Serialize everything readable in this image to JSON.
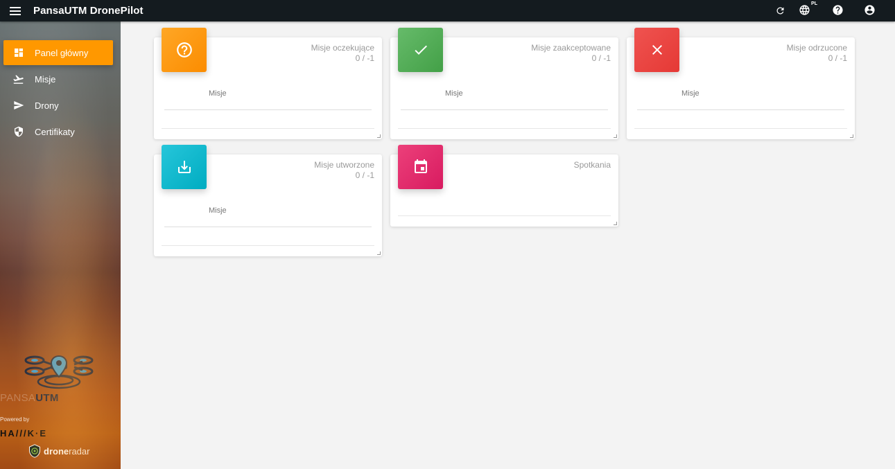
{
  "app": {
    "title": "PansaUTM DronePilot"
  },
  "header": {
    "lang_code": "PL"
  },
  "sidebar": {
    "items": [
      {
        "label": "Panel główny"
      },
      {
        "label": "Misje"
      },
      {
        "label": "Drony"
      },
      {
        "label": "Certifikaty"
      }
    ],
    "branding": {
      "pansa_light": "PANSA",
      "pansa_bold": "UTM",
      "powered_by": "Powered by",
      "hawke": "HA///K·E",
      "droneradar_bold": "drone",
      "droneradar_light": "radar"
    }
  },
  "cards": [
    {
      "title": "Misje oczekujące",
      "value": "0 / -1",
      "label": "Misje",
      "color": "#fb8c00",
      "icon": "help-circle-icon"
    },
    {
      "title": "Misje zaakceptowane",
      "value": "0 / -1",
      "label": "Misje",
      "color": "#43a047",
      "icon": "check-icon"
    },
    {
      "title": "Misje odrzucone",
      "value": "0 / -1",
      "label": "Misje",
      "color": "#e53935",
      "icon": "close-icon"
    },
    {
      "title": "Misje utworzone",
      "value": "0 / -1",
      "label": "Misje",
      "color": "#00acc1",
      "icon": "download-icon"
    },
    {
      "title": "Spotkania",
      "color": "#d81b60",
      "icon": "calendar-icon"
    }
  ]
}
